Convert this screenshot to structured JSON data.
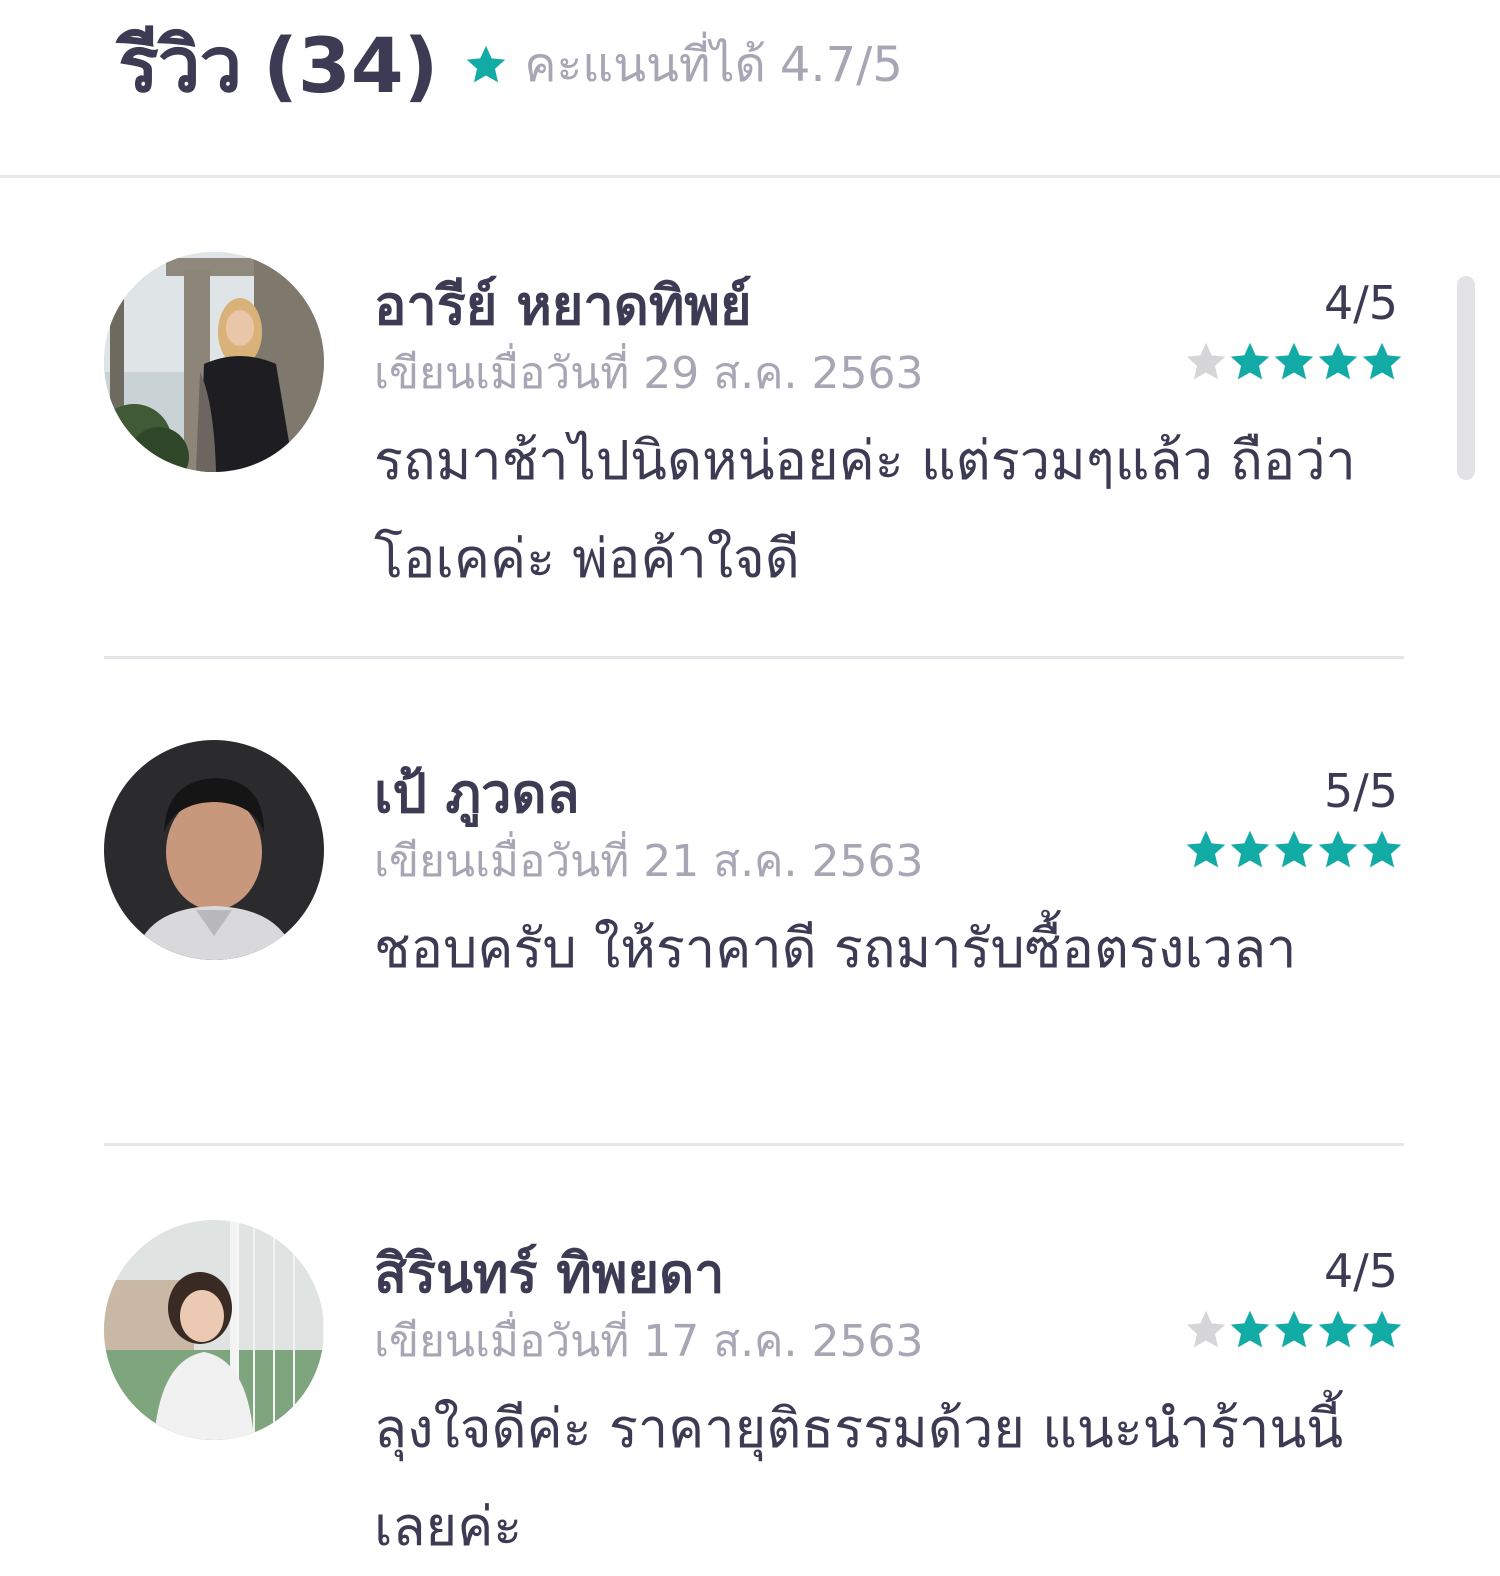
{
  "header": {
    "title": "รีวิว",
    "count": "(34)",
    "score_label": "คะแนนที่ได้",
    "score": "4.7/5",
    "star_icon": "star-icon"
  },
  "colors": {
    "accent": "#12aba5",
    "text": "#3d3b54",
    "muted": "#a8a6b4",
    "star_empty": "#d6d6d8",
    "divider": "#e6e6ea"
  },
  "reviews": [
    {
      "name": "อารีย์ หยาดทิพย์",
      "date_label": "เขียนเมื่อวันที่",
      "date": "29 ส.ค. 2563",
      "rating_text": "4/5",
      "rating": 4,
      "comment": "รถมาช้าไปนิดหน่อยค่ะ แต่รวมๆแล้ว ถือว่าโอเคค่ะ พ่อค้าใจดี"
    },
    {
      "name": "เป้ ภูวดล",
      "date_label": "เขียนเมื่อวันที่",
      "date": "21 ส.ค. 2563",
      "rating_text": "5/5",
      "rating": 5,
      "comment": "ชอบครับ ให้ราคาดี รถมารับซื้อตรงเวลา"
    },
    {
      "name": "สิรินทร์ ทิพยดา",
      "date_label": "เขียนเมื่อวันที่",
      "date": "17 ส.ค. 2563",
      "rating_text": "4/5",
      "rating": 4,
      "comment": "ลุงใจดีค่ะ ราคายุติธรรมด้วย แนะนำร้านนี้เลยค่ะ"
    }
  ]
}
